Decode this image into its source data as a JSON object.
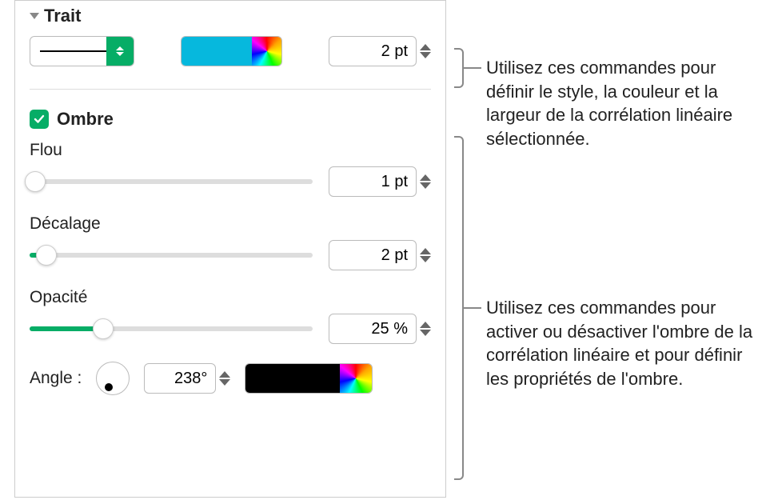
{
  "trait": {
    "title": "Trait",
    "width_value": "2 pt"
  },
  "shadow": {
    "checkbox_label": "Ombre",
    "checked": true,
    "blur_label": "Flou",
    "blur_value": "1 pt",
    "blur_pct": 2,
    "offset_label": "Décalage",
    "offset_value": "2 pt",
    "offset_pct": 6,
    "opacity_label": "Opacité",
    "opacity_value": "25 %",
    "opacity_pct": 26,
    "angle_label": "Angle :",
    "angle_value": "238°"
  },
  "callouts": {
    "c1": "Utilisez ces commandes pour définir le style, la couleur et la largeur de la corrélation linéaire sélectionnée.",
    "c2": "Utilisez ces commandes pour activer ou désactiver l'ombre de la corrélation linéaire et pour définir les propriétés de l'ombre."
  },
  "colors": {
    "stroke": "#06b8dd",
    "shadow": "#000000"
  }
}
